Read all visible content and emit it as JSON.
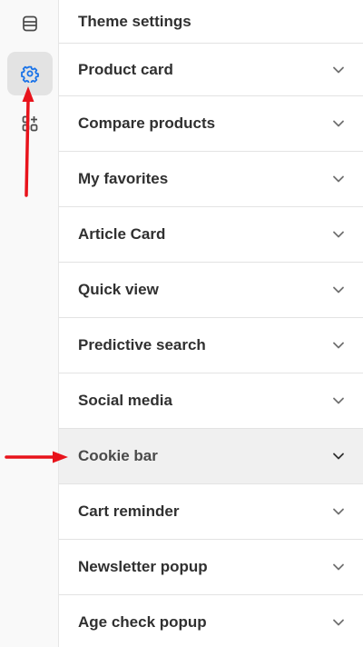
{
  "panel": {
    "title": "Theme settings"
  },
  "rail": {
    "items": [
      {
        "name": "sections",
        "icon": "sections-icon"
      },
      {
        "name": "theme-settings",
        "icon": "gear-icon",
        "active": true
      },
      {
        "name": "apps",
        "icon": "apps-add-icon"
      }
    ]
  },
  "settings": {
    "items": [
      {
        "label": "Product card"
      },
      {
        "label": "Compare products"
      },
      {
        "label": "My favorites"
      },
      {
        "label": "Article Card"
      },
      {
        "label": "Quick view"
      },
      {
        "label": "Predictive search"
      },
      {
        "label": "Social media"
      },
      {
        "label": "Cookie bar",
        "highlighted": true
      },
      {
        "label": "Cart reminder"
      },
      {
        "label": "Newsletter popup"
      },
      {
        "label": "Age check popup"
      }
    ]
  },
  "colors": {
    "accent": "#1a73e8",
    "annotation": "#e8131b",
    "text": "#303030",
    "divider": "#e3e3e3"
  }
}
